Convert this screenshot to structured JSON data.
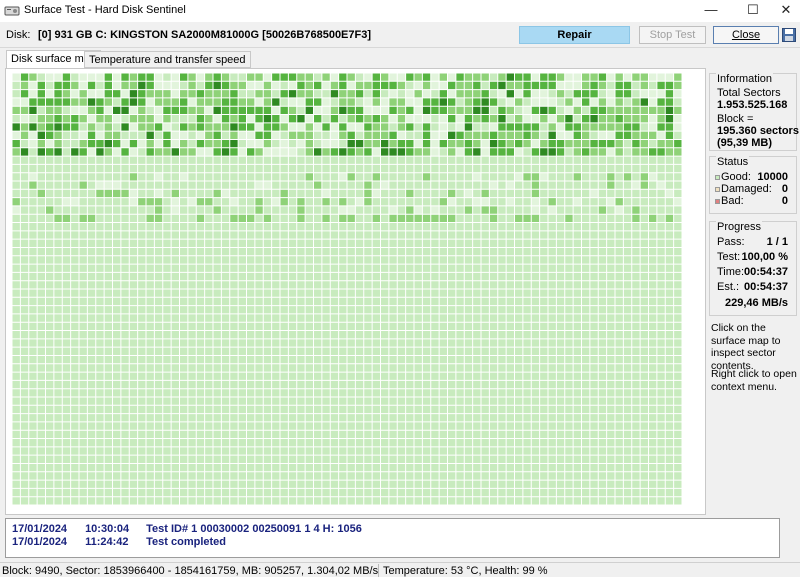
{
  "window": {
    "title": "Surface Test - Hard Disk Sentinel",
    "minimize_glyph": "—",
    "maximize_glyph": "☐",
    "close_glyph": "✕",
    "app_icon": "disk-icon"
  },
  "toolbar": {
    "disk_label": "Disk:",
    "disk_value": "[0] 931 GB C: KINGSTON SA2000M81000G [50026B768500E7F3]",
    "repair_label": "Repair",
    "stop_label": "Stop Test",
    "close_label": "Close",
    "save_icon": "floppy-save-icon"
  },
  "tabs": [
    {
      "label": "Disk surface map",
      "active": true
    },
    {
      "label": "Temperature and transfer speed",
      "active": false
    }
  ],
  "surface_map": {
    "columns": 80,
    "rows": 52,
    "total_blocks": 10000,
    "colors": {
      "base": "#c8ebbe",
      "light": "#e2f4dc",
      "mid": "#8fd278",
      "dark": "#56b440",
      "darkest": "#2f8a22",
      "grid": "#ffffff"
    }
  },
  "information": {
    "title": "Information",
    "total_sectors_label": "Total Sectors",
    "total_sectors_value": "1.953.525.168",
    "block_label": "Block =",
    "block_value": "195.360 sectors",
    "block_size": "(95,39 MB)"
  },
  "status": {
    "title": "Status",
    "good_label": "Good:",
    "good_value": "10000",
    "damaged_label": "Damaged:",
    "damaged_value": "0",
    "bad_label": "Bad:",
    "bad_value": "0",
    "good_color": "#c8ebbe",
    "damaged_color": "#f0e0c0",
    "bad_color": "#e08080"
  },
  "progress": {
    "title": "Progress",
    "pass_label": "Pass:",
    "pass_value": "1 / 1",
    "test_label": "Test:",
    "test_value": "100,00 %",
    "time_label": "Time:",
    "time_value": "00:54:37",
    "est_label": "Est.:",
    "est_value": "00:54:37",
    "speed": "229,46 MB/s"
  },
  "hints": {
    "inspect": "Click on the surface map to inspect sector contents.",
    "context": "Right click to open context menu."
  },
  "log": [
    {
      "date": "17/01/2024",
      "time": "10:30:04",
      "message": "Test ID# 1 00030002 00250091 1 4 H: 1056"
    },
    {
      "date": "17/01/2024",
      "time": "11:24:42",
      "message": "Test completed"
    }
  ],
  "statusbar": {
    "left": "Block: 9490, Sector: 1853966400 - 1854161759, MB: 905257, 1.304,02 MB/s",
    "right": "Temperature: 53 °C,  Health: 99 %"
  }
}
